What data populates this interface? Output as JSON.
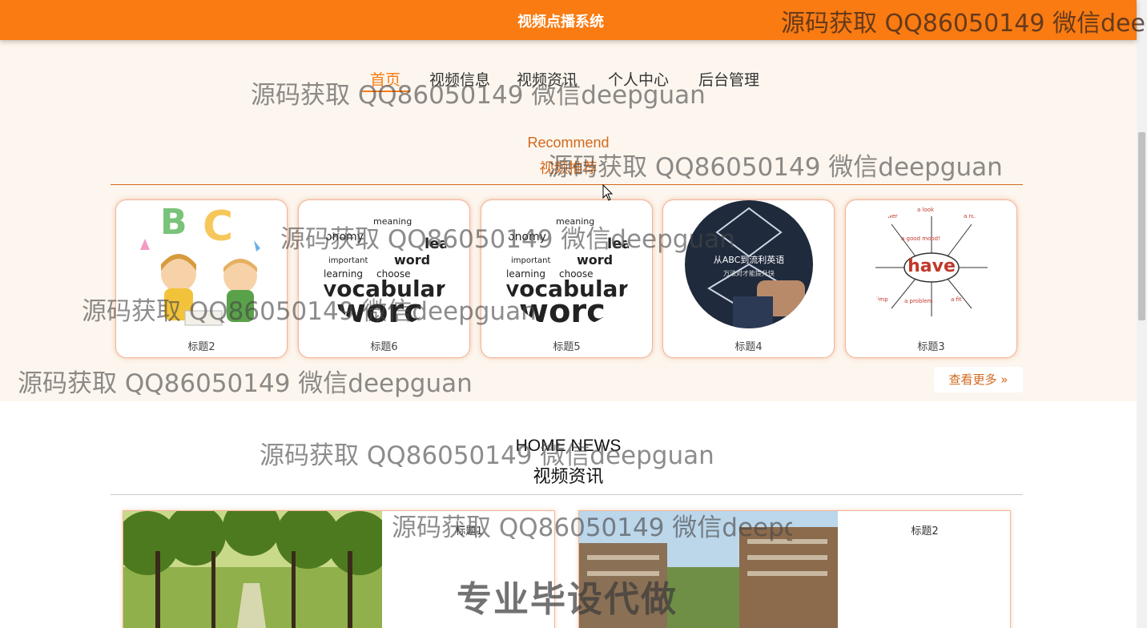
{
  "header": {
    "title": "视频点播系统"
  },
  "nav": {
    "items": [
      {
        "label": "首页",
        "active": true
      },
      {
        "label": "视频信息",
        "active": false
      },
      {
        "label": "视频资讯",
        "active": false
      },
      {
        "label": "个人中心",
        "active": false
      },
      {
        "label": "后台管理",
        "active": false
      }
    ]
  },
  "recommend": {
    "title_en": "Recommend",
    "title_cn": "视频推荐",
    "cards": [
      {
        "title": "标题2",
        "image": "abc-kids-illustration"
      },
      {
        "title": "标题6",
        "image": "vocabulary-word-cloud"
      },
      {
        "title": "标题5",
        "image": "vocabulary-word-cloud"
      },
      {
        "title": "标题4",
        "image": "from-abc-to-fluent-english-photo",
        "image_text": [
          "从ABC到流利英语",
          "万法对才能提升快"
        ]
      },
      {
        "title": "标题3",
        "image": "have-mindmap",
        "image_text": "have"
      }
    ],
    "more_label": "查看更多"
  },
  "news": {
    "title_en": "HOME NEWS",
    "title_cn": "视频资讯",
    "items": [
      {
        "title": "标题1",
        "image": "tree-lined-campus-road"
      },
      {
        "title": "标题2",
        "image": "campus-building"
      }
    ]
  },
  "watermark": {
    "text": "源码获取 QQ86050149 微信deepguan",
    "top_bar_text": "源码获取 QQ86050149 微信deep",
    "stamp": "专业毕设代做"
  },
  "colors": {
    "accent": "#f97b12",
    "heading": "#d2691e",
    "section_bg": "#fcf6ee"
  }
}
